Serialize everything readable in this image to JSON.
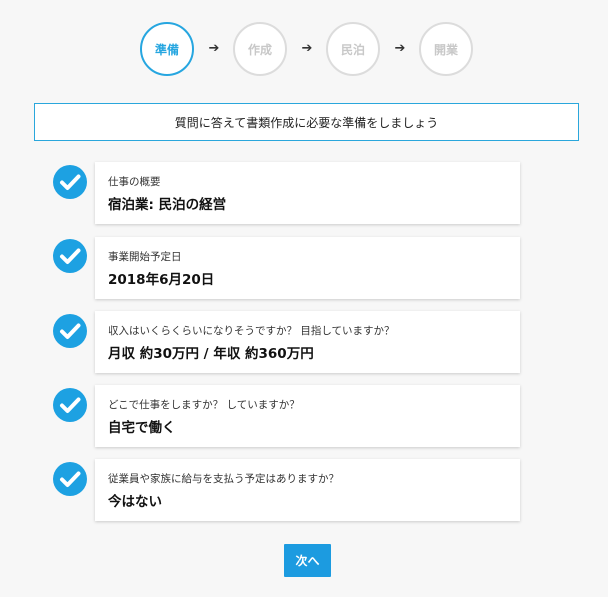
{
  "stepper": {
    "steps": [
      {
        "label": "準備",
        "active": true
      },
      {
        "label": "作成",
        "active": false
      },
      {
        "label": "民泊",
        "active": false
      },
      {
        "label": "開業",
        "active": false
      }
    ],
    "arrow_glyph": "➔"
  },
  "banner": {
    "text": "質問に答えて書類作成に必要な準備をしましょう"
  },
  "answers": [
    {
      "question": "仕事の概要",
      "answer": "宿泊業: 民泊の経営"
    },
    {
      "question": "事業開始予定日",
      "answer": "2018年6月20日"
    },
    {
      "question": "収入はいくらくらいになりそうですか？ 目指していますか？",
      "answer": "月収 約30万円 / 年収 約360万円"
    },
    {
      "question": "どこで仕事をしますか？ していますか？",
      "answer": "自宅で働く"
    },
    {
      "question": "従業員や家族に給与を支払う予定はありますか？",
      "answer": "今はない"
    }
  ],
  "next_button": {
    "label": "次へ"
  },
  "colors": {
    "accent": "#1da1e2",
    "inactive_step": "#dcdcdc",
    "background": "#f7f7f7"
  },
  "icons": {
    "step_check": "check-circle-icon",
    "arrow": "arrow-right-icon"
  }
}
